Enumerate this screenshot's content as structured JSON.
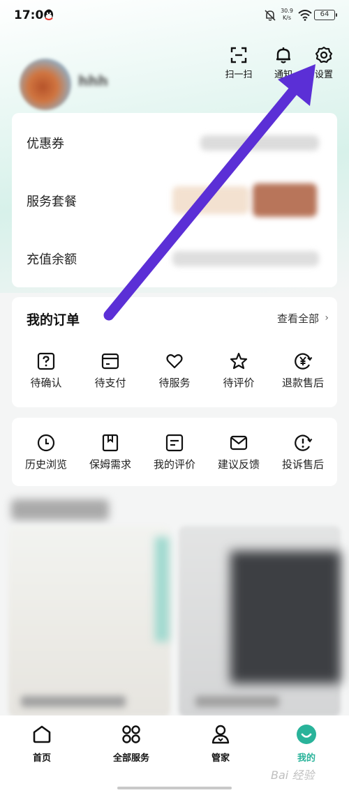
{
  "status_bar": {
    "time": "17:06",
    "net_speed_value": "30.9",
    "net_speed_unit": "K/s",
    "battery": "64"
  },
  "header": {
    "actions": [
      {
        "label": "扫一扫",
        "icon": "scan-icon"
      },
      {
        "label": "通知",
        "icon": "bell-icon"
      },
      {
        "label": "设置",
        "icon": "gear-icon"
      }
    ]
  },
  "wallet": {
    "rows": [
      {
        "label": "优惠券"
      },
      {
        "label": "服务套餐"
      },
      {
        "label": "充值余额"
      }
    ]
  },
  "orders": {
    "title": "我的订单",
    "view_all": "查看全部",
    "items": [
      {
        "label": "待确认",
        "icon": "question-box-icon"
      },
      {
        "label": "待支付",
        "icon": "card-icon"
      },
      {
        "label": "待服务",
        "icon": "heart-icon"
      },
      {
        "label": "待评价",
        "icon": "star-icon"
      },
      {
        "label": "退款售后",
        "icon": "refund-yen-icon"
      }
    ]
  },
  "tools": {
    "items": [
      {
        "label": "历史浏览",
        "icon": "clock-icon"
      },
      {
        "label": "保姆需求",
        "icon": "bookmark-icon"
      },
      {
        "label": "我的评价",
        "icon": "review-icon"
      },
      {
        "label": "建议反馈",
        "icon": "mail-icon"
      },
      {
        "label": "投诉售后",
        "icon": "complaint-icon"
      }
    ]
  },
  "bottom_nav": {
    "items": [
      {
        "label": "首页",
        "icon": "home-icon",
        "active": false
      },
      {
        "label": "全部服务",
        "icon": "grid-icon",
        "active": false
      },
      {
        "label": "管家",
        "icon": "person-icon",
        "active": false
      },
      {
        "label": "我的",
        "icon": "smile-icon",
        "active": true
      }
    ]
  },
  "colors": {
    "accent": "#29b39a",
    "arrow": "#5b2fd6"
  },
  "watermark": "Bai 经验"
}
